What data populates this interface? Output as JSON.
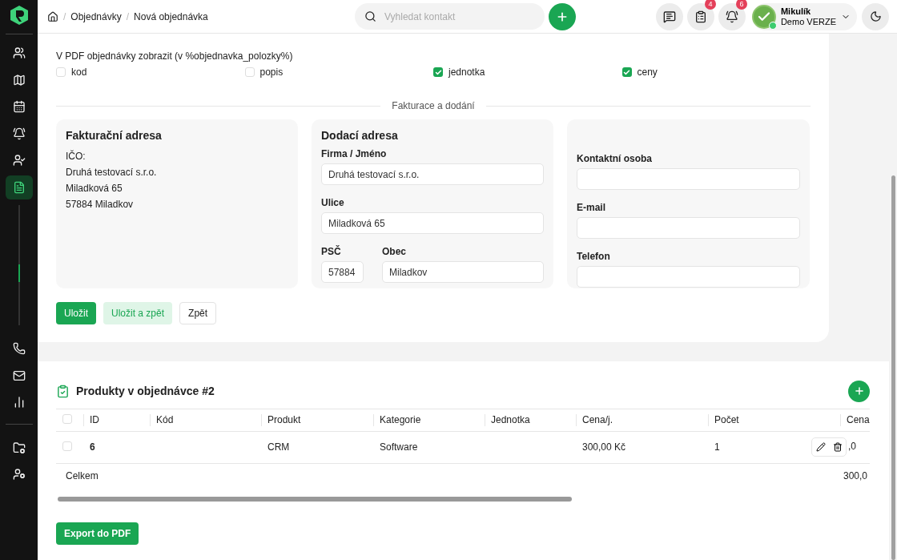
{
  "sidebar": {
    "items": [
      {
        "selected": false
      },
      {
        "selected": false
      },
      {
        "selected": false
      },
      {
        "selected": false
      },
      {
        "selected": false
      },
      {
        "selected": true
      }
    ]
  },
  "breadcrumbs": [
    {
      "separator": "/",
      "label": "Objednávky"
    },
    {
      "separator": "/",
      "label": "Nová objednávka"
    }
  ],
  "search": {
    "placeholder": "Vyhledat kontakt"
  },
  "header_icons": [
    {
      "kind": "messages"
    },
    {
      "kind": "clipboard",
      "badge": "4"
    },
    {
      "kind": "bell",
      "badge": "6"
    }
  ],
  "user": {
    "name": "Mikulík",
    "subtitle": "Demo VERZE",
    "online": true
  },
  "pdf_options": {
    "label": "V PDF objednávky zobrazit (v %objednavka_polozky%)",
    "options": [
      {
        "label": "kod",
        "checked": false
      },
      {
        "label": "popis",
        "checked": false
      },
      {
        "label": "jednotka",
        "checked": true
      },
      {
        "label": "ceny",
        "checked": true
      }
    ]
  },
  "section_divider": "Fakturace a dodání",
  "billing": {
    "title": "Fakturační adresa",
    "lines": [
      "IČO:",
      "Druhá testovací s.r.o.",
      "Miladková 65",
      "57884 Miladkov"
    ]
  },
  "delivery": {
    "title": "Dodací adresa",
    "fields": [
      {
        "label": "Firma / Jméno",
        "value": "Druhá testovací s.r.o."
      },
      {
        "label": "Ulice",
        "value": "Miladková 65"
      },
      {
        "label": "PSČ",
        "value": "57884"
      },
      {
        "label": "Obec",
        "value": "Miladkov"
      }
    ]
  },
  "contact": {
    "fields": [
      {
        "label": "Kontaktní osoba"
      },
      {
        "label": "E-mail"
      },
      {
        "label": "Telefon"
      }
    ]
  },
  "form_buttons": [
    {
      "label": "Uložit",
      "kind": "primary"
    },
    {
      "label": "Uložit a zpět",
      "kind": "soft"
    },
    {
      "label": "Zpět",
      "kind": "outline"
    }
  ],
  "products": {
    "title": "Produkty v objednávce #2",
    "select_all_checked": false,
    "columns": [
      "ID",
      "Kód",
      "Produkt",
      "Kategorie",
      "Jednotka",
      "Cena/j.",
      "Počet",
      "Cena"
    ],
    "rows": [
      {
        "checked": false,
        "cells": [
          "6",
          null,
          "CRM",
          "Software",
          null,
          "300,00 Kč",
          "1",
          ",0"
        ]
      }
    ],
    "total": {
      "label": "Celkem",
      "value": "300,0"
    },
    "export_button": "Export do PDF"
  }
}
